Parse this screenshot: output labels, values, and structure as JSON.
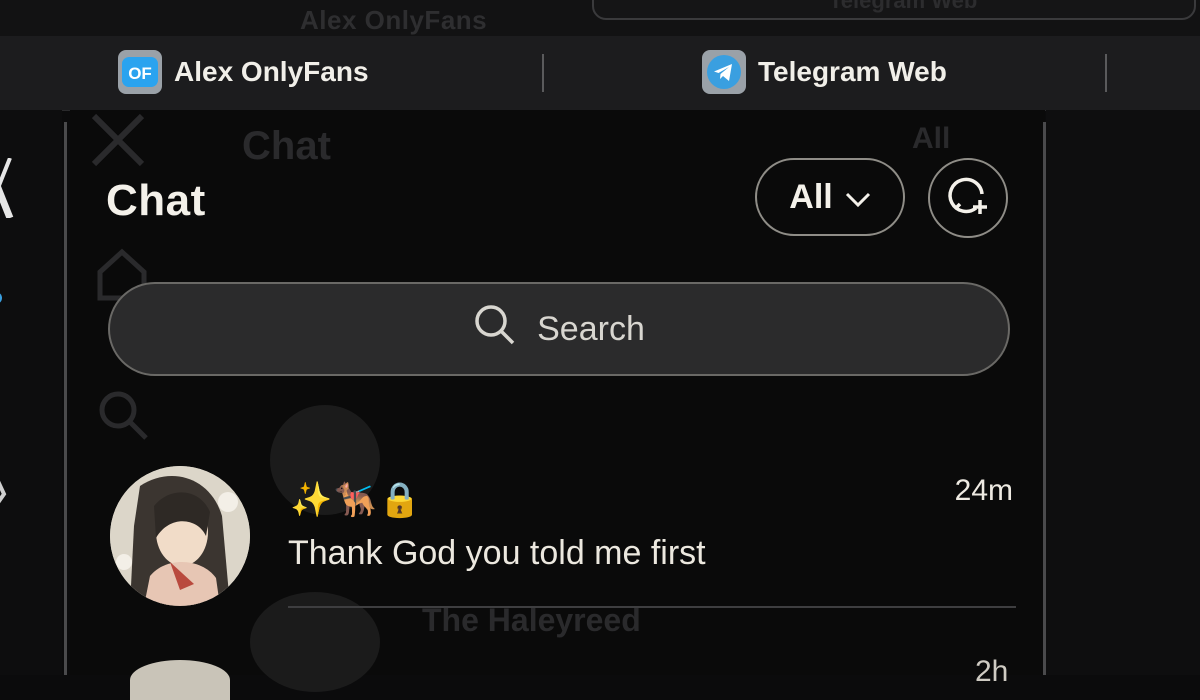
{
  "top": {
    "ghost_title": "Alex OnlyFans",
    "ghost_right": "Telegram Web"
  },
  "tabs": [
    {
      "label": "Alex OnlyFans",
      "favicon": "onlyfans-icon",
      "badge": "OF"
    },
    {
      "label": "Telegram Web",
      "favicon": "telegram-icon"
    }
  ],
  "reflection": {
    "title": "Chat",
    "filter": "All",
    "row_name": "The Haleyreed"
  },
  "header": {
    "title": "Chat",
    "filter_label": "All"
  },
  "search": {
    "placeholder": "Search"
  },
  "conversations": [
    {
      "name_emojis": "✨🐕‍🦺🔒",
      "time": "24m",
      "preview": "Thank God you told me first"
    },
    {
      "time": "2h"
    }
  ],
  "colors": {
    "background": "#0a0a0a",
    "text": "#f4f1ea",
    "search_bg": "#2b2b2c",
    "telegram": "#3a9fe0",
    "onlyfans": "#2aa3ef"
  }
}
